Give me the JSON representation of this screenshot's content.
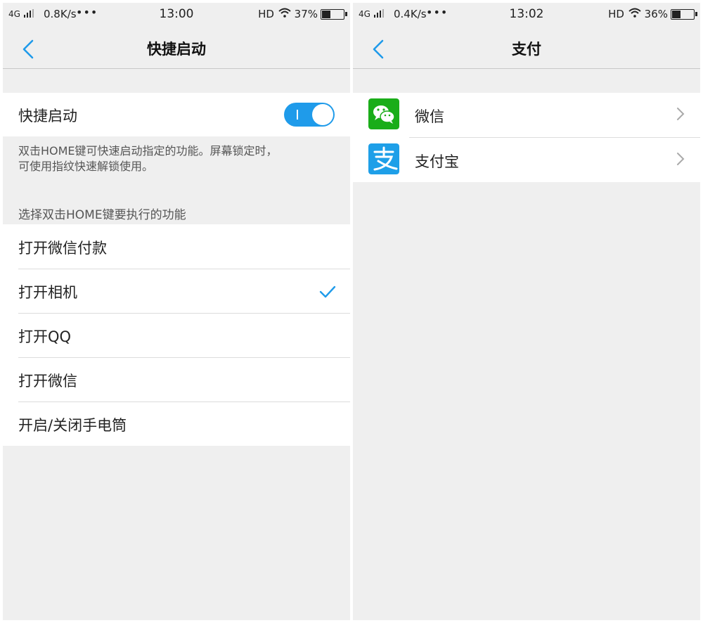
{
  "left_screen": {
    "status": {
      "network": "4G",
      "speed": "0.8K/s",
      "dots": "•••",
      "time": "13:00",
      "hd": "HD",
      "battery_pct": "37%",
      "battery_level": 0.37
    },
    "title": "快捷启动",
    "toggle_row": {
      "label": "快捷启动",
      "on": true
    },
    "description": [
      "双击HOME键可快速启动指定的功能。屏幕锁定时，",
      "可使用指纹快速解锁使用。"
    ],
    "section_header": "选择双击HOME键要执行的功能",
    "options": [
      {
        "label": "打开微信付款",
        "selected": false
      },
      {
        "label": "打开相机",
        "selected": true
      },
      {
        "label": "打开QQ",
        "selected": false
      },
      {
        "label": "打开微信",
        "selected": false
      },
      {
        "label": "开启/关闭手电筒",
        "selected": false
      }
    ]
  },
  "right_screen": {
    "status": {
      "network": "4G",
      "speed": "0.4K/s",
      "dots": "•••",
      "time": "13:02",
      "hd": "HD",
      "battery_pct": "36%",
      "battery_level": 0.36
    },
    "title": "支付",
    "items": [
      {
        "label": "微信",
        "icon": "wechat-icon"
      },
      {
        "label": "支付宝",
        "icon": "alipay-icon"
      }
    ]
  },
  "colors": {
    "accent": "#1f9bea",
    "wechat_green": "#1aad19",
    "alipay_blue": "#1e9fe8",
    "background": "#efefef"
  }
}
